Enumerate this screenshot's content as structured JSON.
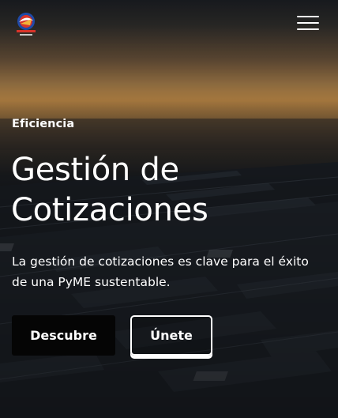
{
  "header": {
    "logo_name": "brand-logo",
    "menu_icon": "hamburger-menu-icon"
  },
  "hero": {
    "eyebrow": "Eficiencia",
    "title_line1": "Gestión de",
    "title_line2": "Cotizaciones",
    "description": "La gestión de cotizaciones es clave para el éxito de una PyME sustentable.",
    "primary_button": "Descubre",
    "secondary_button": "Únete"
  },
  "colors": {
    "text": "#ffffff",
    "primary_button_bg": "#050505",
    "sky_glow": "#a7793f"
  }
}
